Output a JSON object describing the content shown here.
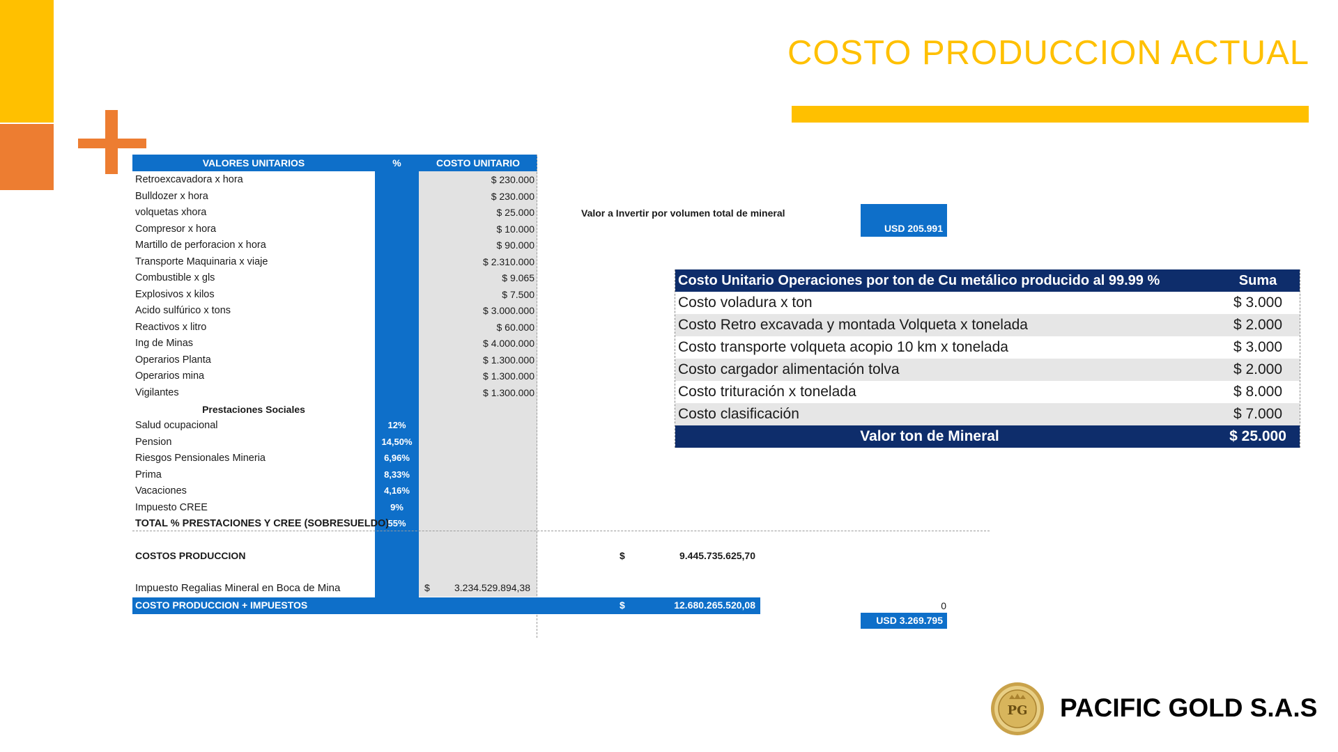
{
  "title": "COSTO PRODUCCION ACTUAL",
  "left_table": {
    "headers": {
      "label": "VALORES UNITARIOS",
      "pct": "%",
      "cost": "COSTO UNITARIO"
    },
    "rows": [
      {
        "label": "Retroexcavadora x hora",
        "value": "$ 230.000"
      },
      {
        "label": "Bulldozer x hora",
        "value": "$ 230.000"
      },
      {
        "label": "volquetas xhora",
        "value": "$ 25.000"
      },
      {
        "label": "Compresor x hora",
        "value": "$ 10.000"
      },
      {
        "label": "Martillo de perforacion x hora",
        "value": "$ 90.000"
      },
      {
        "label": "Transporte Maquinaria x viaje",
        "value": "$ 2.310.000"
      },
      {
        "label": "Combustible x gls",
        "value": "$ 9.065"
      },
      {
        "label": "Explosivos x kilos",
        "value": "$ 7.500"
      },
      {
        "label": "Acido sulfúrico x tons",
        "value": "$ 3.000.000"
      },
      {
        "label": "Reactivos x litro",
        "value": "$ 60.000"
      },
      {
        "label": "Ing de Minas",
        "value": "$ 4.000.000"
      },
      {
        "label": "Operarios Planta",
        "value": "$ 1.300.000"
      },
      {
        "label": "Operarios mina",
        "value": "$ 1.300.000"
      },
      {
        "label": "Vigilantes",
        "value": "$ 1.300.000"
      }
    ],
    "subheader": "Prestaciones Sociales",
    "prestaciones": [
      {
        "label": "Salud ocupacional",
        "pct": "12%"
      },
      {
        "label": "Pension",
        "pct": "14,50%"
      },
      {
        "label": "Riesgos Pensionales Mineria",
        "pct": "6,96%"
      },
      {
        "label": "Prima",
        "pct": "8,33%"
      },
      {
        "label": "Vacaciones",
        "pct": "4,16%"
      },
      {
        "label": "Impuesto CREE",
        "pct": "9%"
      }
    ],
    "total_prest": {
      "label": "TOTAL % PRESTACIONES Y CREE (SOBRESUELDO)",
      "pct": "55%"
    },
    "costos": {
      "label": "COSTOS PRODUCCION",
      "currency": "$",
      "value": "9.445.735.625,70"
    },
    "impuesto": {
      "label": "Impuesto Regalias Mineral en Boca de Mina",
      "currency": "$",
      "value": "3.234.529.894,38"
    },
    "total": {
      "label": "COSTO PRODUCCION + IMPUESTOS",
      "currency": "$",
      "value": "12.680.265.520,08"
    },
    "zero": "0",
    "usd_total": "USD 3.269.795"
  },
  "inversion": {
    "label": "Valor a Invertir por volumen total de mineral",
    "usd": "USD 205.991"
  },
  "right_table": {
    "header": {
      "label": "Costo Unitario Operaciones por ton de Cu metálico producido al  99.99 %",
      "sum": "Suma"
    },
    "rows": [
      {
        "label": "Costo voladura x ton",
        "value": "$ 3.000"
      },
      {
        "label": "Costo Retro excavada y montada Volqueta x tonelada",
        "value": "$ 2.000"
      },
      {
        "label": "Costo transporte volqueta acopio 10 km x tonelada",
        "value": "$ 3.000"
      },
      {
        "label": "Costo cargador alimentación tolva",
        "value": "$ 2.000"
      },
      {
        "label": "Costo trituración x tonelada",
        "value": "$ 8.000"
      },
      {
        "label": "Costo clasificación",
        "value": "$ 7.000"
      }
    ],
    "footer": {
      "label": "Valor ton de Mineral",
      "value": "$ 25.000"
    }
  },
  "brand": {
    "logo_text": "PG",
    "name": "PACIFIC GOLD S.A.S"
  },
  "colors": {
    "yellow": "#ffc000",
    "orange": "#ed7d31",
    "blue": "#0e6fc9",
    "navy": "#0e2d6b"
  }
}
